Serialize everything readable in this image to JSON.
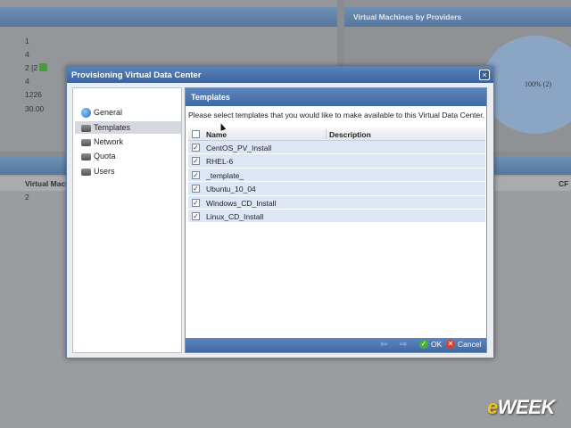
{
  "background": {
    "stats": [
      "1",
      "4",
      "2 [2",
      "4",
      "1226",
      "30.00"
    ],
    "right_panel_title": "Virtual Machines by Providers",
    "pie_label": "100% (2)",
    "table": {
      "col_left": "Virtual Machi",
      "col_right": "CF",
      "row_value": "2"
    }
  },
  "dialog": {
    "title": "Provisioning Virtual Data Center",
    "close_symbol": "×",
    "nav": [
      {
        "label": "General",
        "icon": "globe-icon",
        "selected": false
      },
      {
        "label": "Templates",
        "icon": "drive-icon",
        "selected": true
      },
      {
        "label": "Network",
        "icon": "drive-icon",
        "selected": false
      },
      {
        "label": "Quota",
        "icon": "drive-icon",
        "selected": false
      },
      {
        "label": "Users",
        "icon": "drive-icon",
        "selected": false
      }
    ],
    "panel_title": "Templates",
    "instructions": "Please select templates that you would like to make available to this Virtual Data Center.",
    "columns": {
      "name": "Name",
      "description": "Description"
    },
    "select_all_checked": false,
    "templates": [
      {
        "name": "CentOS_PV_Install",
        "description": "",
        "checked": true
      },
      {
        "name": "RHEL-6",
        "description": "",
        "checked": true
      },
      {
        "name": "_template_",
        "description": "",
        "checked": true
      },
      {
        "name": "Ubuntu_10_04",
        "description": "",
        "checked": true
      },
      {
        "name": "Windows_CD_Install",
        "description": "",
        "checked": true
      },
      {
        "name": "Linux_CD_Install",
        "description": "",
        "checked": true
      }
    ],
    "footer": {
      "ok_label": "OK",
      "cancel_label": "Cancel"
    }
  },
  "watermark": {
    "prefix": "e",
    "suffix": "WEEK"
  },
  "colors": {
    "title_bar": "#4a72ad",
    "row_bg": "#dce6f4",
    "ok": "#4caf3a",
    "cancel": "#d9402c"
  }
}
